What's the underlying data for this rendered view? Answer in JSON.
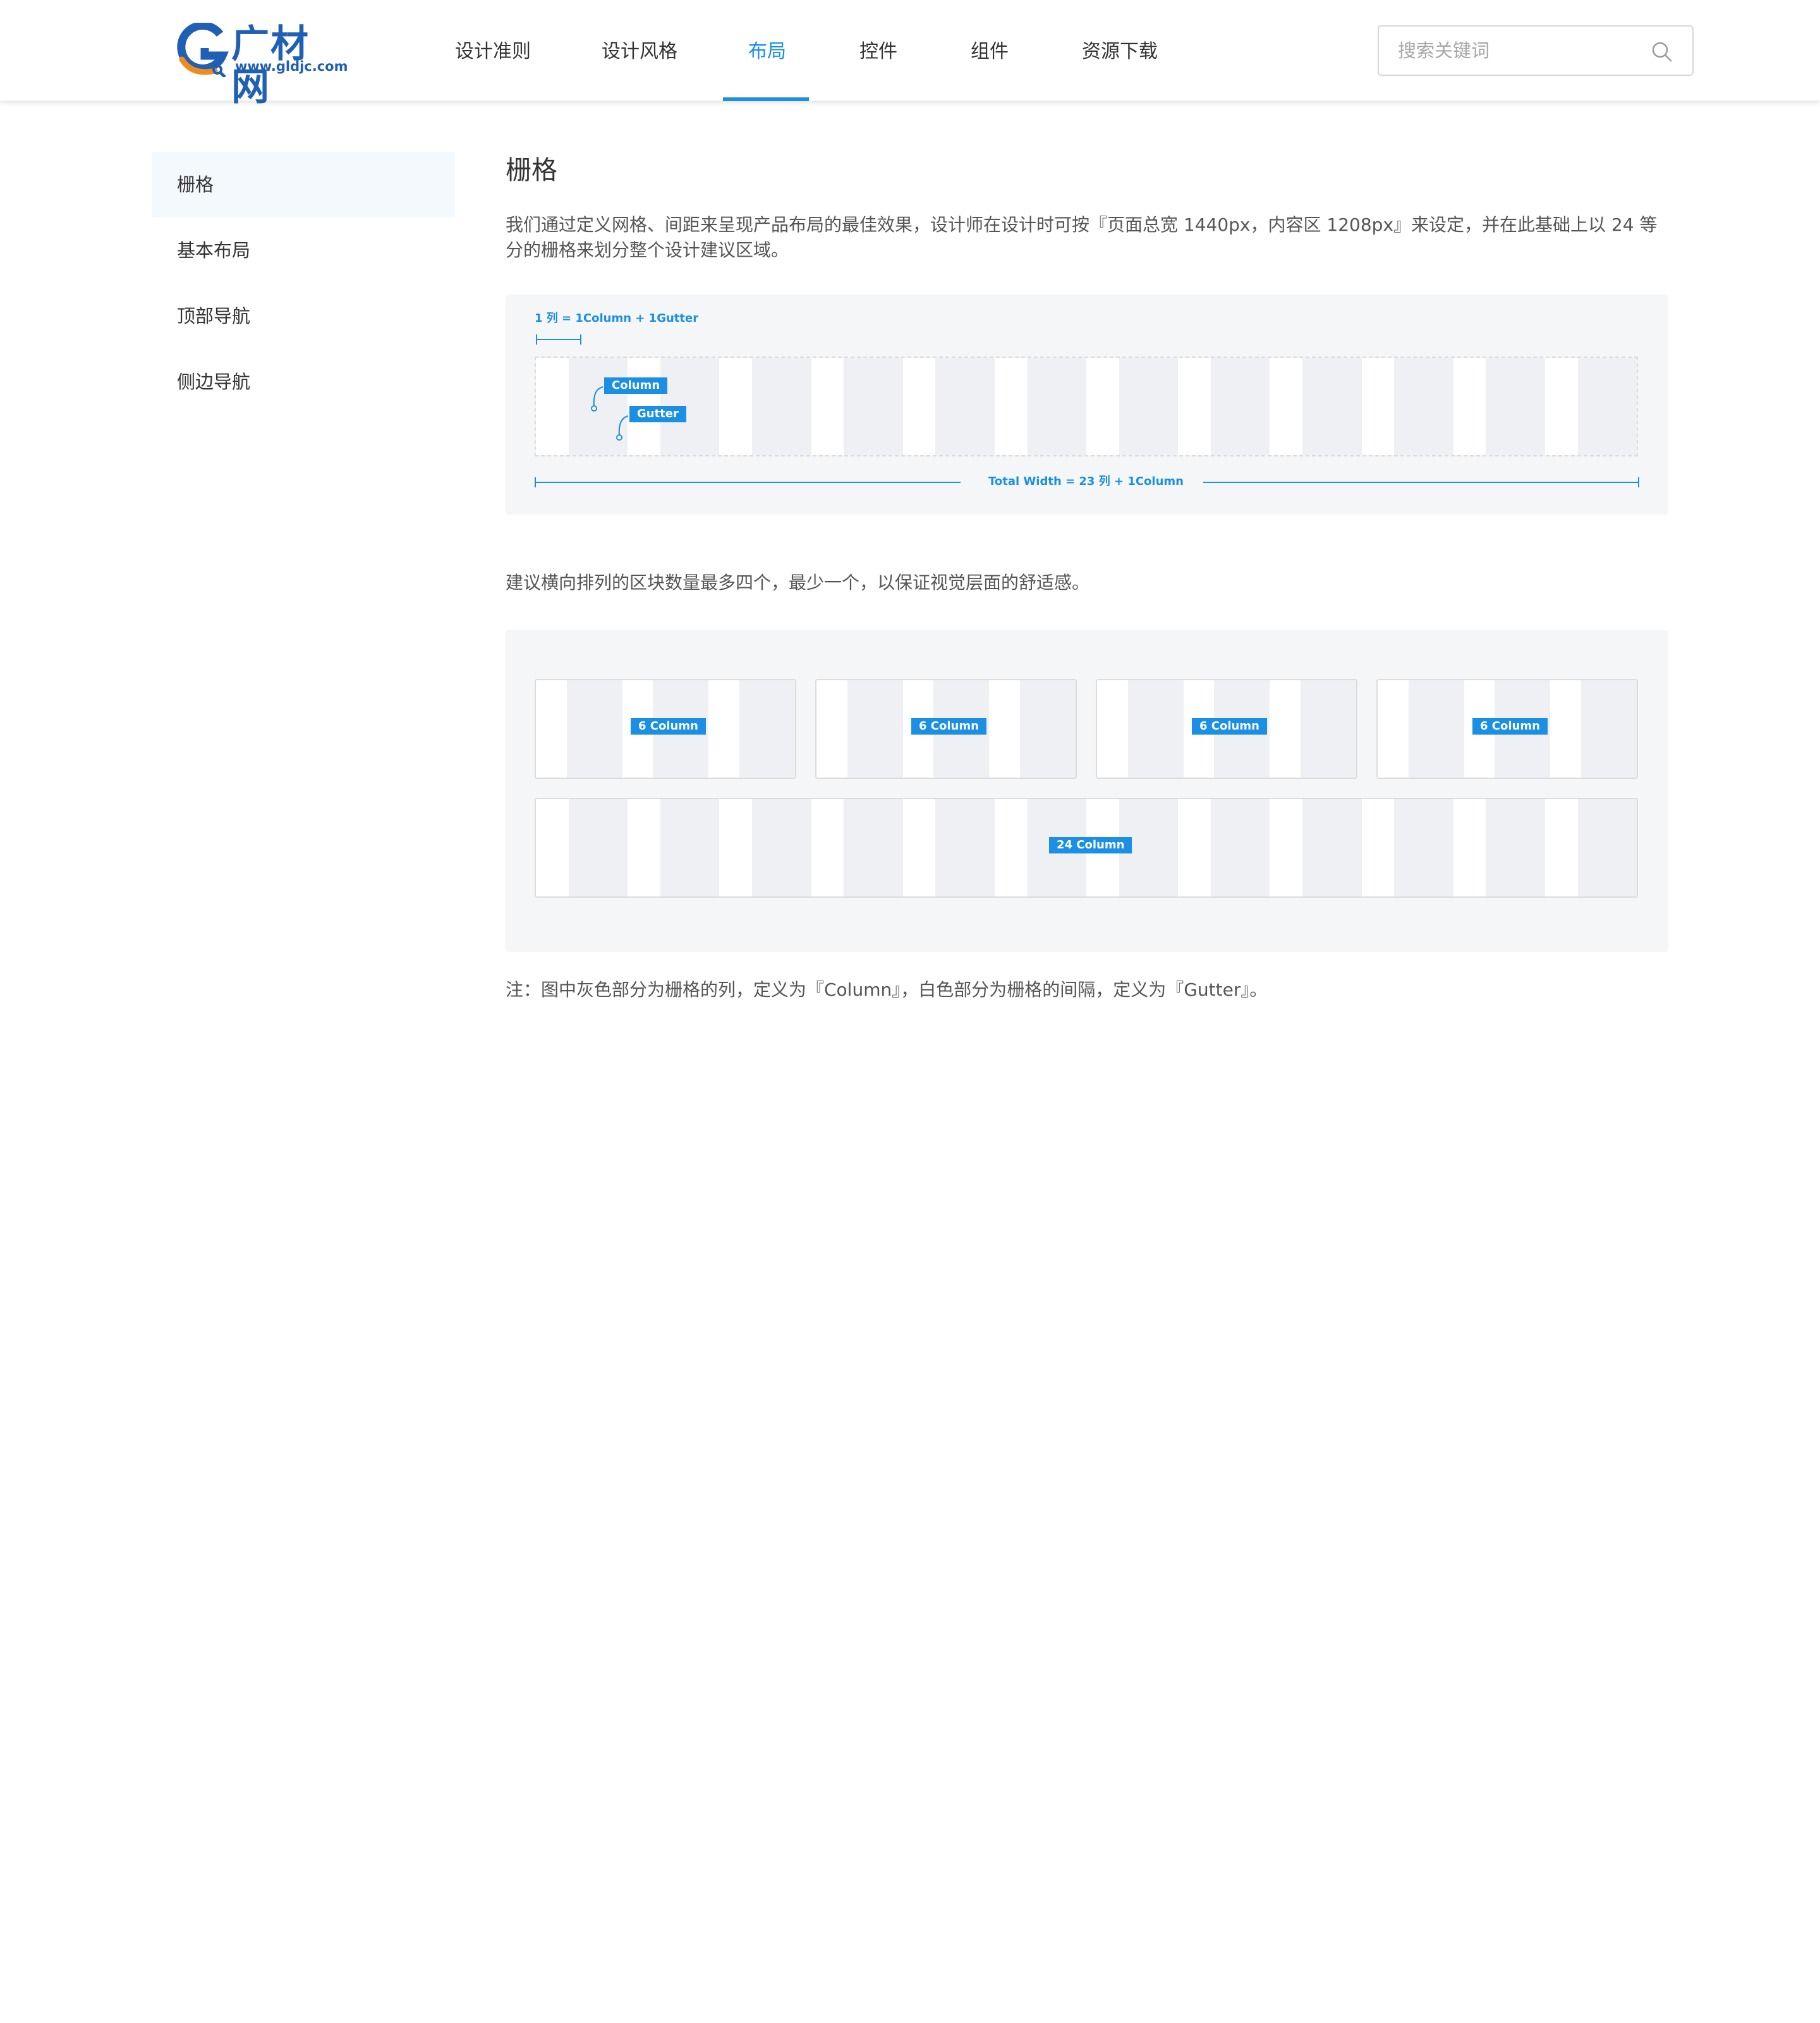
{
  "header": {
    "logo": {
      "name": "广材网",
      "url": "www.gldjc.com"
    },
    "nav": [
      {
        "label": "设计准则",
        "active": false
      },
      {
        "label": "设计风格",
        "active": false
      },
      {
        "label": "布局",
        "active": true
      },
      {
        "label": "控件",
        "active": false
      },
      {
        "label": "组件",
        "active": false
      },
      {
        "label": "资源下载",
        "active": false
      }
    ],
    "search": {
      "placeholder": "搜索关键词",
      "icon": "search-icon"
    }
  },
  "sidebar": {
    "items": [
      {
        "label": "栅格",
        "active": true
      },
      {
        "label": "基本布局",
        "active": false
      },
      {
        "label": "顶部导航",
        "active": false
      },
      {
        "label": "侧边导航",
        "active": false
      }
    ]
  },
  "main": {
    "title": "栅格",
    "intro": "我们通过定义网格、间距来呈现产品布局的最佳效果，设计师在设计时可按『页面总宽 1440px，内容区 1208px』来设定，并在此基础上以 24 等分的栅格来划分整个设计建议区域。",
    "diagram1": {
      "unit_label": "1 列 = 1Column + 1Gutter",
      "column_tag": "Column",
      "gutter_tag": "Gutter",
      "total_label": "Total Width = 23 列 +  1Column"
    },
    "recommendation": "建议横向排列的区块数量最多四个，最少一个，以保证视觉层面的舒适感。",
    "diagram2": {
      "blocks": [
        "6 Column",
        "6 Column",
        "6 Column",
        "6 Column"
      ],
      "full_block": "24 Column"
    },
    "note": "注：图中灰色部分为栅格的列，定义为『Column』，白色部分为栅格的间隔，定义为『Gutter』。"
  },
  "colors": {
    "accent": "#1a8fe3",
    "brand": "#1f5fb4",
    "logo_orange": "#f08c1e",
    "column_gray": "#eef0f3",
    "gutter_white": "#ffffff",
    "panel_bg": "#f5f6f8"
  }
}
